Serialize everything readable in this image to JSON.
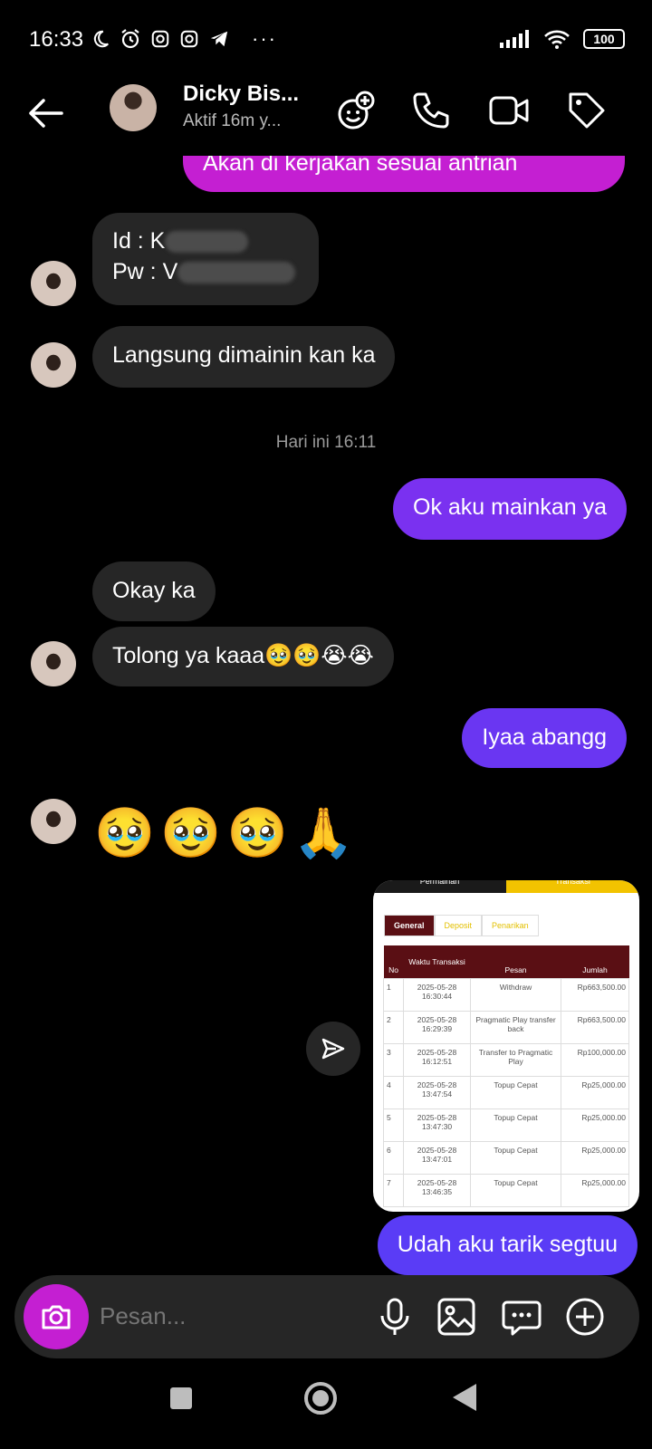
{
  "status_bar": {
    "time": "16:33",
    "battery": "100",
    "icons": [
      "moon-icon",
      "alarm-icon",
      "instagram-icon",
      "instagram-icon",
      "telegram-icon",
      "more-icon",
      "signal-icon",
      "wifi-icon",
      "battery-icon"
    ]
  },
  "header": {
    "contact_name": "Dicky Bis...",
    "status": "Aktif 16m y..."
  },
  "messages": {
    "m1": "Akan di kerjakan sesuai antrian",
    "m2_line1": "Id : K",
    "m2_line2": "Pw : V",
    "m3": "Langsung dimainin kan ka",
    "timestamp": "Hari ini 16:11",
    "m4": "Ok aku mainkan ya",
    "m5": "Okay ka",
    "m6": "Tolong ya kaaa🥹🥹😭😭",
    "m7": "Iyaa abangg",
    "m8_emojis": [
      "🥹",
      "🥹",
      "🥹",
      "🙏"
    ],
    "m9": "Udah aku tarik segtuu"
  },
  "screenshot": {
    "tabs": [
      "Permainan",
      "Transaksi"
    ],
    "subtabs": [
      "General",
      "Deposit",
      "Penarikan"
    ],
    "columns": [
      "No",
      "Waktu Transaksi",
      "Pesan",
      "Jumlah"
    ],
    "rows": [
      [
        "1",
        "2025-05-28 16:30:44",
        "Withdraw",
        "Rp663,500.00"
      ],
      [
        "2",
        "2025-05-28 16:29:39",
        "Pragmatic Play transfer back",
        "Rp663,500.00"
      ],
      [
        "3",
        "2025-05-28 16:12:51",
        "Transfer to Pragmatic Play",
        "Rp100,000.00"
      ],
      [
        "4",
        "2025-05-28 13:47:54",
        "Topup Cepat",
        "Rp25,000.00"
      ],
      [
        "5",
        "2025-05-28 13:47:30",
        "Topup Cepat",
        "Rp25,000.00"
      ],
      [
        "6",
        "2025-05-28 13:47:01",
        "Topup Cepat",
        "Rp25,000.00"
      ],
      [
        "7",
        "2025-05-28 13:46:35",
        "Topup Cepat",
        "Rp25,000.00"
      ]
    ]
  },
  "composer": {
    "placeholder": "Pesan..."
  },
  "colors": {
    "outgoing_magenta": "#c41fd2",
    "outgoing_purple": "#7a31f0",
    "outgoing_blue": "#5b3cf5",
    "incoming": "#262626"
  }
}
